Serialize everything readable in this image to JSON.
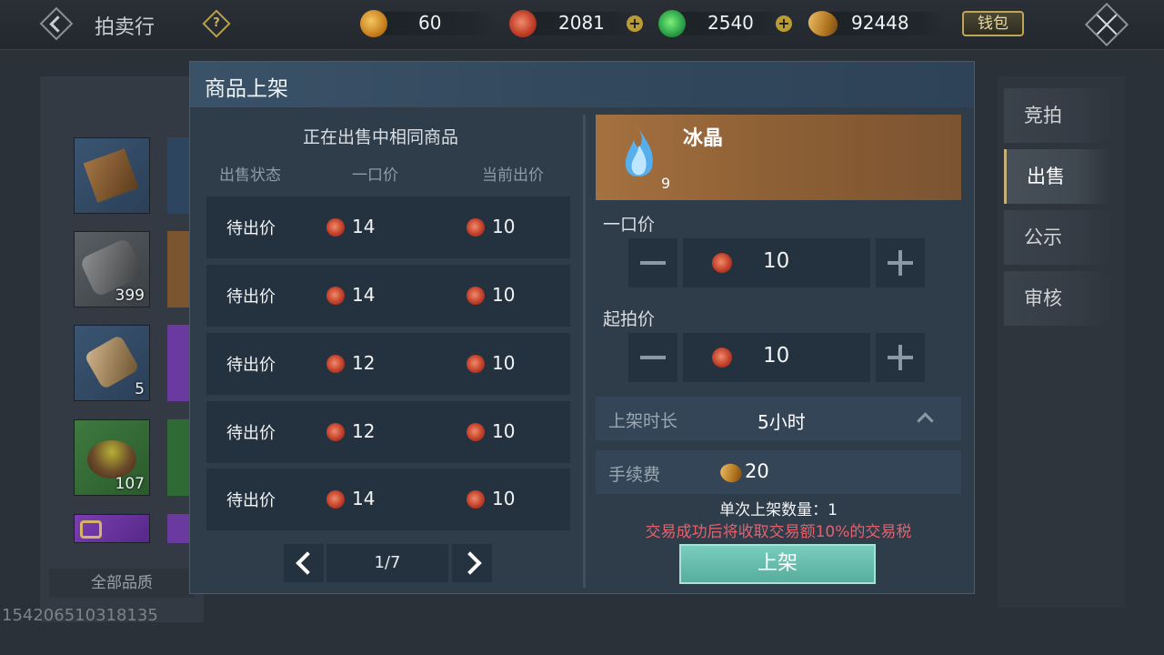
{
  "header": {
    "title": "拍卖行",
    "help_glyph": "?",
    "currencies": [
      {
        "icon": "gold-ingot-icon",
        "value": "60"
      },
      {
        "icon": "red-coin-icon",
        "value": "2081"
      },
      {
        "icon": "jade-coin-icon",
        "value": "2540"
      },
      {
        "icon": "gold-leaf-icon",
        "value": "92448"
      }
    ],
    "wallet_label": "钱包"
  },
  "inventory": {
    "slots": [
      {
        "count": ""
      },
      {
        "count": "399"
      },
      {
        "count": "5"
      },
      {
        "count": "107"
      },
      {
        "count": ""
      }
    ],
    "quality_filter": "全部品质",
    "uid": "154206510318135"
  },
  "tabs": [
    {
      "label": "竞拍",
      "active": false
    },
    {
      "label": "出售",
      "active": true
    },
    {
      "label": "公示",
      "active": false
    },
    {
      "label": "审核",
      "active": false
    }
  ],
  "dialog": {
    "title": "商品上架",
    "listing": {
      "title": "正在出售中相同商品",
      "columns": [
        "出售状态",
        "一口价",
        "当前出价"
      ],
      "rows": [
        {
          "status": "待出价",
          "buyout": "14",
          "current": "10"
        },
        {
          "status": "待出价",
          "buyout": "14",
          "current": "10"
        },
        {
          "status": "待出价",
          "buyout": "12",
          "current": "10"
        },
        {
          "status": "待出价",
          "buyout": "12",
          "current": "10"
        },
        {
          "status": "待出价",
          "buyout": "14",
          "current": "10"
        }
      ],
      "page": "1/7"
    },
    "item": {
      "name": "冰晶",
      "count": "9"
    },
    "buyout_label": "一口价",
    "buyout_value": "10",
    "start_label": "起拍价",
    "start_value": "10",
    "duration_label": "上架时长",
    "duration_value": "5小时",
    "fee_label": "手续费",
    "fee_value": "20",
    "qty_text": "单次上架数量：1",
    "tax_text": "交易成功后将收取交易额10%的交易税",
    "submit_label": "上架"
  },
  "colors": {
    "accent_teal": "#6cc2b2",
    "tax_warning": "#e2626c",
    "item_bg": "#a5713f"
  }
}
